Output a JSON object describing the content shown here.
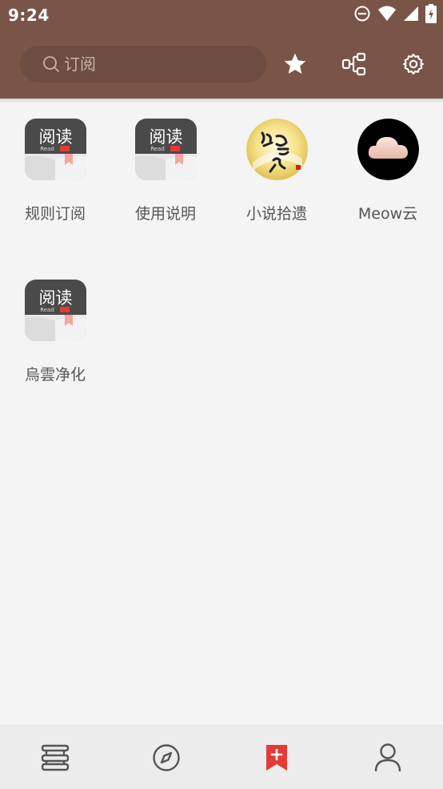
{
  "status_bar": {
    "time": "9:24",
    "icons": [
      "do-not-disturb-icon",
      "wifi-icon",
      "signal-icon",
      "battery-charging-icon"
    ]
  },
  "search": {
    "placeholder": "订阅",
    "value": ""
  },
  "header_actions": [
    {
      "name": "star-icon"
    },
    {
      "name": "group-icon"
    },
    {
      "name": "gear-icon"
    }
  ],
  "sources": [
    {
      "label": "规则订阅",
      "icon": "app-read-logo-icon"
    },
    {
      "label": "使用说明",
      "icon": "app-read-logo-icon"
    },
    {
      "label": "小说拾遗",
      "icon": "storyteller-logo-icon"
    },
    {
      "label": "Meow云",
      "icon": "cloud-logo-icon"
    },
    {
      "label": "烏雲净化",
      "icon": "app-read-logo-icon"
    }
  ],
  "bottom_nav": {
    "items": [
      {
        "name": "bookshelf-icon"
      },
      {
        "name": "discover-compass-icon"
      },
      {
        "name": "subscription-bookmark-icon",
        "active": true
      },
      {
        "name": "profile-person-icon"
      }
    ],
    "active_color": "#e53935",
    "inactive_color": "#555555"
  },
  "colors": {
    "header": "#795548",
    "search_bg": "#6d4c41",
    "page_bg": "#f4f4f4"
  }
}
